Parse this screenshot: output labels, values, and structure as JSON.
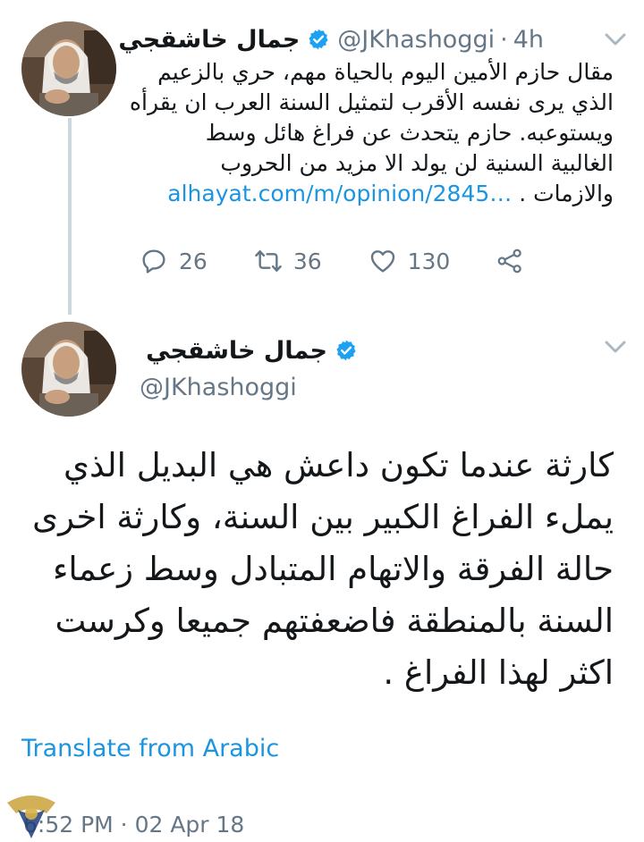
{
  "tweet1": {
    "name": "جمال خاشقجي",
    "handle": "@JKhashoggi",
    "separator": "·",
    "time": "4h",
    "lines": [
      "مقال حازم الأمين اليوم بالحياة مهم، حري بالزعيم",
      "الذي يرى نفسه الأقرب لتمثيل السنة العرب ان يقرأه",
      "ويستوعبه. حازم يتحدث عن فراغ هائل وسط",
      "الغالبية السنية لن يولد الا مزيد من الحروب"
    ],
    "last_line_text": "والازمات . ",
    "link": "alhayat.com/m/opinion/2845…",
    "replies": "26",
    "retweets": "36",
    "likes": "130"
  },
  "tweet2": {
    "name": "جمال خاشقجي",
    "handle": "@JKhashoggi",
    "lines": [
      "كارثة عندما تكون داعش هي البديل الذي",
      "يملء الفراغ الكبير بين السنة، وكارثة اخرى",
      "حالة الفرقة والاتهام المتبادل وسط زعماء",
      "السنة بالمنطقة فاضعفتهم جميعا وكرست",
      "اكثر لهذا الفراغ ."
    ],
    "translate": "Translate from Arabic",
    "timestamp": "6:52 PM · 02 Apr 18"
  },
  "icons": {
    "reply": "reply-icon",
    "retweet": "retweet-icon",
    "like": "heart-icon",
    "share": "share-icon",
    "verified": "verified-badge-icon",
    "menu": "chevron-down-icon"
  },
  "colors": {
    "link": "#1b95e0",
    "secondary": "#657786",
    "verified": "#1da1f2",
    "thread_line": "#ccd6dd"
  }
}
